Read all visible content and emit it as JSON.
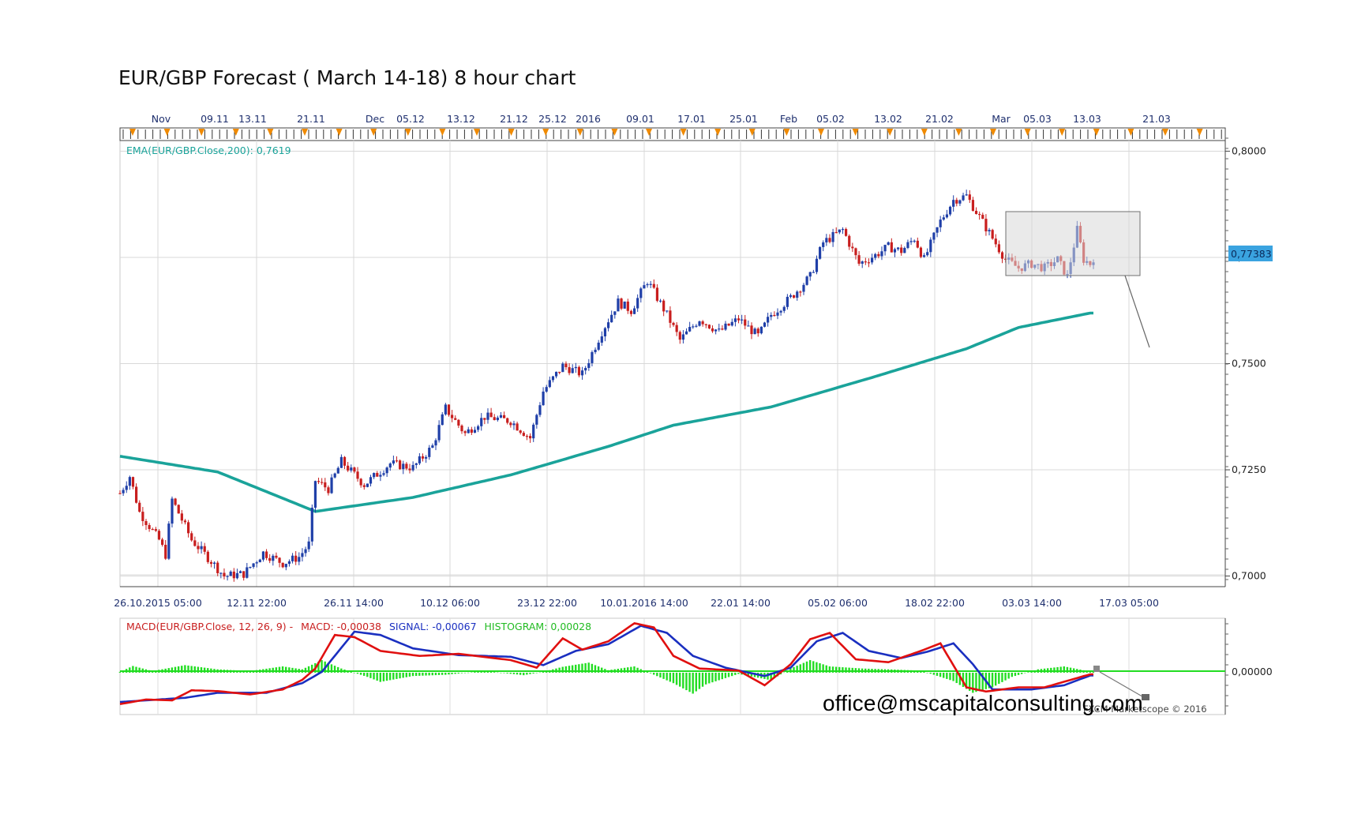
{
  "title": "EUR/GBP Forecast ( March 14-18) 8 hour chart",
  "email": "office@mscapitalconsulting.com",
  "copyright": "FXCM Marketscope © 2016",
  "colors": {
    "bull_candle": "#1f3fa8",
    "bear_candle": "#c81e1e",
    "ema": "#1aa39a",
    "macd_line": "#e01010",
    "signal_line": "#1a2fc0",
    "histogram": "#22dd22",
    "price_tag": "#3aa3e0",
    "tick_marker": "#f08a00"
  },
  "chart_data": [
    {
      "type": "candlestick",
      "indicator_label": "EMA(EUR/GBP.Close,200): 0,7619",
      "top_ticks": [
        "Nov",
        "09.11",
        "13.11",
        "21.11",
        "Dec",
        "05.12",
        "13.12",
        "21.12",
        "25.12",
        "2016",
        "09.01",
        "17.01",
        "25.01",
        "Feb",
        "05.02",
        "13.02",
        "21.02",
        "Mar",
        "05.03",
        "13.03",
        "21.03"
      ],
      "bottom_ticks": [
        "26.10.2015 05:00",
        "12.11 22:00",
        "26.11 14:00",
        "10.12 06:00",
        "23.12 22:00",
        "10.01.2016 14:00",
        "22.01 14:00",
        "05.02 06:00",
        "18.02 22:00",
        "03.03 14:00",
        "17.03 05:00"
      ],
      "y_ticks": [
        "0,8000",
        "0,7750",
        "0,7500",
        "0,7250",
        "0,7000"
      ],
      "ylim": [
        0.6975,
        0.8025
      ],
      "last_price_label": "0,77383",
      "last_price": 0.77383,
      "price_anchors": [
        [
          0,
          0.7195
        ],
        [
          3,
          0.7235
        ],
        [
          6,
          0.715
        ],
        [
          12,
          0.7085
        ],
        [
          14,
          0.705
        ],
        [
          16,
          0.718
        ],
        [
          22,
          0.7085
        ],
        [
          28,
          0.7035
        ],
        [
          32,
          0.7
        ],
        [
          38,
          0.7005
        ],
        [
          44,
          0.7055
        ],
        [
          50,
          0.703
        ],
        [
          55,
          0.7045
        ],
        [
          58,
          0.7075
        ],
        [
          60,
          0.7225
        ],
        [
          64,
          0.7205
        ],
        [
          68,
          0.727
        ],
        [
          75,
          0.7215
        ],
        [
          83,
          0.7265
        ],
        [
          90,
          0.7255
        ],
        [
          96,
          0.7305
        ],
        [
          100,
          0.7395
        ],
        [
          106,
          0.7335
        ],
        [
          112,
          0.7375
        ],
        [
          120,
          0.7365
        ],
        [
          126,
          0.7325
        ],
        [
          130,
          0.7435
        ],
        [
          136,
          0.7495
        ],
        [
          142,
          0.7475
        ],
        [
          148,
          0.7575
        ],
        [
          153,
          0.7645
        ],
        [
          157,
          0.7625
        ],
        [
          162,
          0.7695
        ],
        [
          168,
          0.7615
        ],
        [
          172,
          0.7555
        ],
        [
          178,
          0.7605
        ],
        [
          184,
          0.7575
        ],
        [
          190,
          0.7605
        ],
        [
          196,
          0.7565
        ],
        [
          200,
          0.7615
        ],
        [
          206,
          0.7655
        ],
        [
          212,
          0.7705
        ],
        [
          216,
          0.7785
        ],
        [
          222,
          0.7815
        ],
        [
          227,
          0.7735
        ],
        [
          232,
          0.7755
        ],
        [
          236,
          0.7775
        ],
        [
          240,
          0.7765
        ],
        [
          244,
          0.7795
        ],
        [
          247,
          0.7745
        ],
        [
          252,
          0.7835
        ],
        [
          256,
          0.7885
        ],
        [
          260,
          0.7895
        ],
        [
          264,
          0.7845
        ],
        [
          268,
          0.7795
        ],
        [
          272,
          0.7745
        ],
        [
          276,
          0.7725
        ],
        [
          280,
          0.7735
        ],
        [
          284,
          0.7725
        ],
        [
          288,
          0.7745
        ],
        [
          291,
          0.7705
        ],
        [
          294,
          0.7815
        ],
        [
          296,
          0.7745
        ],
        [
          298,
          0.7735
        ]
      ],
      "ema_values": [
        [
          0,
          0.7282
        ],
        [
          30,
          0.7245
        ],
        [
          60,
          0.7152
        ],
        [
          90,
          0.7185
        ],
        [
          120,
          0.7238
        ],
        [
          150,
          0.7305
        ],
        [
          170,
          0.7355
        ],
        [
          200,
          0.7398
        ],
        [
          230,
          0.7465
        ],
        [
          260,
          0.7535
        ],
        [
          276,
          0.7585
        ],
        [
          298,
          0.7619
        ]
      ],
      "annotation": "box around recent consolidation with projected decline arrow"
    },
    {
      "type": "line",
      "indicator_label": "MACD(EUR/GBP.Close, 12, 26, 9) -",
      "macd_label": "MACD: -0,00038",
      "signal_label": "SIGNAL: -0,00067",
      "histogram_label": "HISTOGRAM: 0,00028",
      "y_ticks": [
        "0,00000"
      ],
      "macd_anchors": [
        [
          0,
          -0.0075
        ],
        [
          8,
          -0.0064
        ],
        [
          16,
          -0.0066
        ],
        [
          22,
          -0.0042
        ],
        [
          30,
          -0.0044
        ],
        [
          40,
          -0.0052
        ],
        [
          50,
          -0.004
        ],
        [
          56,
          -0.0017
        ],
        [
          60,
          0.001
        ],
        [
          66,
          0.009
        ],
        [
          72,
          0.0085
        ],
        [
          80,
          0.0052
        ],
        [
          92,
          0.004
        ],
        [
          104,
          0.0045
        ],
        [
          120,
          0.003
        ],
        [
          128,
          0.0012
        ],
        [
          136,
          0.0082
        ],
        [
          142,
          0.0055
        ],
        [
          150,
          0.0075
        ],
        [
          158,
          0.0118
        ],
        [
          164,
          0.0108
        ],
        [
          170,
          0.004
        ],
        [
          178,
          0.001
        ],
        [
          190,
          0.0005
        ],
        [
          198,
          -0.003
        ],
        [
          206,
          0.002
        ],
        [
          212,
          0.008
        ],
        [
          218,
          0.0095
        ],
        [
          226,
          0.0032
        ],
        [
          236,
          0.0025
        ],
        [
          246,
          0.0052
        ],
        [
          252,
          0.007
        ],
        [
          260,
          -0.0035
        ],
        [
          266,
          -0.0045
        ],
        [
          276,
          -0.0035
        ],
        [
          284,
          -0.0035
        ],
        [
          298,
          -0.00038
        ]
      ],
      "signal_anchors": [
        [
          0,
          -0.007
        ],
        [
          20,
          -0.006
        ],
        [
          30,
          -0.0048
        ],
        [
          45,
          -0.0048
        ],
        [
          56,
          -0.0025
        ],
        [
          62,
          0.0002
        ],
        [
          72,
          0.0098
        ],
        [
          80,
          0.009
        ],
        [
          90,
          0.0058
        ],
        [
          104,
          0.0042
        ],
        [
          120,
          0.0038
        ],
        [
          130,
          0.0018
        ],
        [
          140,
          0.0052
        ],
        [
          150,
          0.0068
        ],
        [
          160,
          0.0112
        ],
        [
          168,
          0.0095
        ],
        [
          176,
          0.004
        ],
        [
          186,
          0.0012
        ],
        [
          198,
          -0.0008
        ],
        [
          206,
          0.0012
        ],
        [
          214,
          0.0075
        ],
        [
          222,
          0.0095
        ],
        [
          230,
          0.0052
        ],
        [
          240,
          0.0035
        ],
        [
          248,
          0.005
        ],
        [
          256,
          0.007
        ],
        [
          262,
          0.002
        ],
        [
          268,
          -0.004
        ],
        [
          280,
          -0.004
        ],
        [
          290,
          -0.003
        ],
        [
          298,
          -0.00067
        ]
      ],
      "histogram_anchors": [
        [
          0,
          0.0002
        ],
        [
          4,
          0.0016
        ],
        [
          10,
          0.0004
        ],
        [
          20,
          0.0018
        ],
        [
          30,
          0.0008
        ],
        [
          40,
          0.0004
        ],
        [
          50,
          0.0015
        ],
        [
          56,
          0.0008
        ],
        [
          62,
          0.003
        ],
        [
          68,
          0.001
        ],
        [
          76,
          -0.001
        ],
        [
          80,
          -0.0022
        ],
        [
          90,
          -0.0008
        ],
        [
          100,
          -0.0005
        ],
        [
          112,
          0.0004
        ],
        [
          124,
          -0.0006
        ],
        [
          130,
          0.0002
        ],
        [
          136,
          0.0014
        ],
        [
          144,
          0.0024
        ],
        [
          150,
          0.0006
        ],
        [
          158,
          0.0015
        ],
        [
          162,
          0.0002
        ],
        [
          170,
          -0.0025
        ],
        [
          176,
          -0.005
        ],
        [
          180,
          -0.0028
        ],
        [
          190,
          -0.0003
        ],
        [
          200,
          -0.0018
        ],
        [
          206,
          0.001
        ],
        [
          212,
          0.003
        ],
        [
          218,
          0.0015
        ],
        [
          228,
          0.001
        ],
        [
          236,
          0.0008
        ],
        [
          246,
          0.0005
        ],
        [
          256,
          -0.002
        ],
        [
          262,
          -0.0048
        ],
        [
          268,
          -0.0035
        ],
        [
          274,
          -0.001
        ],
        [
          282,
          0.0008
        ],
        [
          290,
          0.0015
        ],
        [
          298,
          0.00028
        ]
      ],
      "ylim": [
        -0.01,
        0.013
      ]
    }
  ]
}
